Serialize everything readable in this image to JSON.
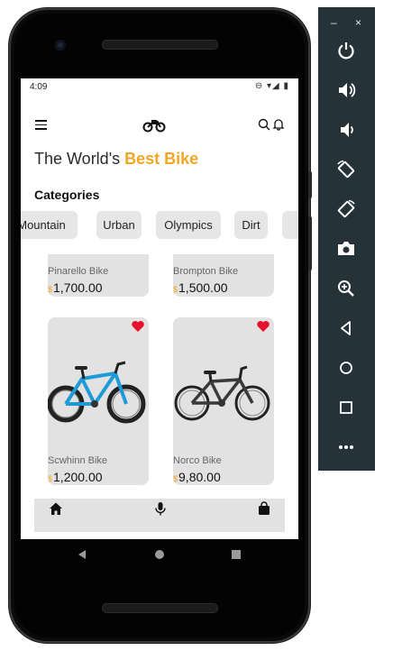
{
  "status_bar": {
    "time": "4:09",
    "icons": "⊖ ▾◢ ▮"
  },
  "appbar": {
    "menu_icon": "menu-icon",
    "logo_icon": "motorcycle-icon",
    "search_icon": "search-icon",
    "bell_icon": "bell-icon"
  },
  "headline": {
    "prefix": "The World's ",
    "accent": "Best Bike"
  },
  "categories": {
    "title": "Categories",
    "items": [
      "Mountain",
      "Urban",
      "Olympics",
      "Dirt"
    ]
  },
  "products": [
    {
      "name": "Pinarello Bike",
      "currency": "$",
      "price": "1,700.00"
    },
    {
      "name": "Brompton Bike",
      "currency": "$",
      "price": "1,500.00"
    },
    {
      "name": "Scwhinn Bike",
      "currency": "$",
      "price": "1,200.00",
      "favorite": true
    },
    {
      "name": "Norco Bike",
      "currency": "$",
      "price": "9,80.00",
      "favorite": true
    }
  ],
  "bottom_nav": [
    "home-icon",
    "microphone-icon",
    "shopping-bag-icon"
  ],
  "emulator": {
    "window_buttons": [
      "–",
      "×"
    ],
    "tools": [
      "power-icon",
      "volume-up-icon",
      "volume-down-icon",
      "rotate-left-icon",
      "rotate-right-icon",
      "camera-icon",
      "zoom-icon",
      "back-icon",
      "home-circle-icon",
      "overview-icon",
      "more-icon"
    ]
  },
  "colors": {
    "accent": "#f5a623",
    "heart": "#e8112d",
    "card": "#e2e2e2",
    "panel": "#25323a",
    "bike_blue": "#1e9ad6"
  }
}
